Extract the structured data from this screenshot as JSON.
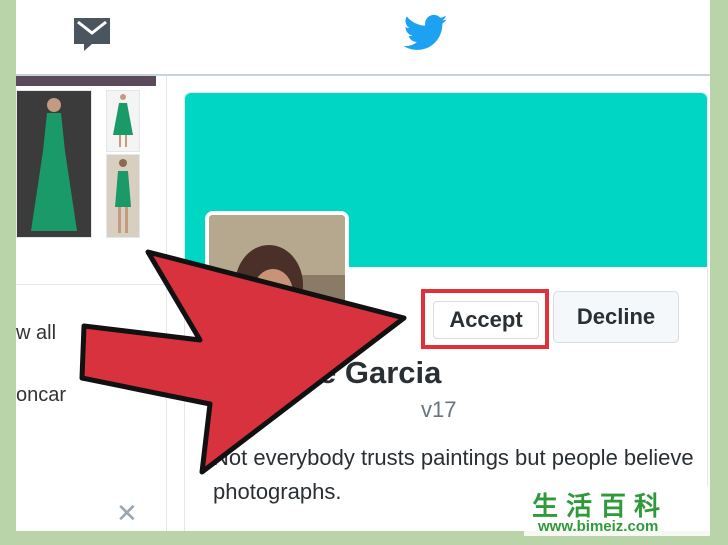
{
  "nav": {
    "icons": [
      "mail-icon",
      "twitter-bird-icon"
    ]
  },
  "sidebar": {
    "view_all_label": "w all",
    "handle_partial": "oncar"
  },
  "profile": {
    "name_partial": "e Garcia",
    "handle_partial": "v17",
    "bio": "Not everybody trusts paintings but people believe photographs.",
    "accept_label": "Accept",
    "decline_label": "Decline"
  },
  "watermark": {
    "chars": "生活百科",
    "url": "www.bimeiz.com"
  },
  "colors": {
    "banner": "#00d6c4",
    "highlight": "#e0303a",
    "arrow": "#d9323f",
    "background": "#b8d4a8",
    "twitter_blue": "#1da1f2"
  }
}
